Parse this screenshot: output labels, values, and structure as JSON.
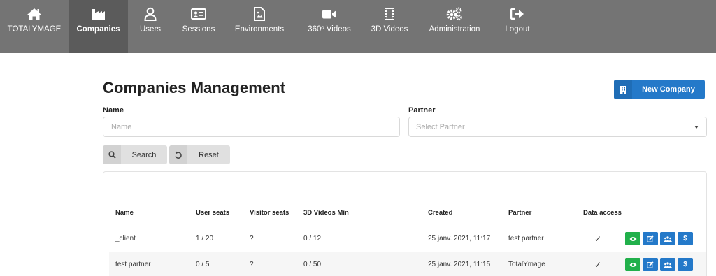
{
  "nav": {
    "items": [
      {
        "label": "TOTALYMAGE",
        "icon": "home-icon"
      },
      {
        "label": "Companies",
        "icon": "factory-icon",
        "active": true
      },
      {
        "label": "Users",
        "icon": "user-icon"
      },
      {
        "label": "Sessions",
        "icon": "id-card-icon"
      },
      {
        "label": "Environments",
        "icon": "file-image-icon"
      },
      {
        "label": "360º Videos",
        "icon": "video-camera-icon"
      },
      {
        "label": "3D Videos",
        "icon": "film-icon"
      },
      {
        "label": "Administration",
        "icon": "gears-icon"
      },
      {
        "label": "Logout",
        "icon": "logout-icon"
      }
    ]
  },
  "page": {
    "title": "Companies Management",
    "new_company_label": "New Company"
  },
  "filters": {
    "name_label": "Name",
    "name_placeholder": "Name",
    "partner_label": "Partner",
    "partner_placeholder": "Select Partner",
    "search_label": "Search",
    "reset_label": "Reset"
  },
  "table": {
    "headers": [
      "Name",
      "User seats",
      "Visitor seats",
      "3D Videos Min",
      "Created",
      "Partner",
      "Data access"
    ],
    "rows": [
      {
        "name": "_client",
        "user_seats": "1 / 20",
        "visitor_seats": "?",
        "videos_min": "0 / 12",
        "created": "25 janv. 2021, 11:17",
        "partner": "test partner",
        "data_access": "✓"
      },
      {
        "name": "test partner",
        "user_seats": "0 / 5",
        "visitor_seats": "?",
        "videos_min": "0 / 50",
        "created": "25 janv. 2021, 11:15",
        "partner": "TotalYmage",
        "data_access": "✓"
      }
    ],
    "action_icons": [
      "eye-icon",
      "edit-icon",
      "users-icon",
      "dollar-icon"
    ],
    "dollar_glyph": "$"
  },
  "colors": {
    "nav_bg": "#747474",
    "nav_active_bg": "#5b5b5b",
    "primary": "#2479c9",
    "success": "#21b04b"
  }
}
